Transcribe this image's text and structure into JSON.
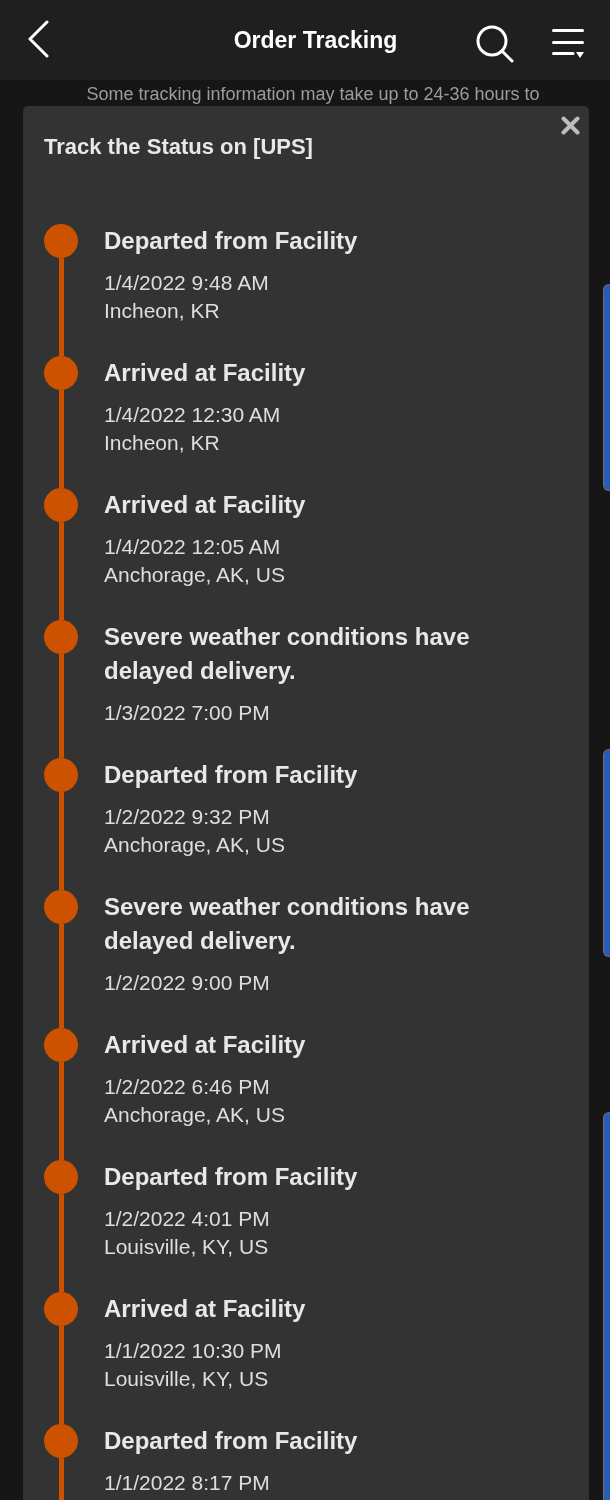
{
  "header": {
    "title": "Order Tracking"
  },
  "notice": "Some tracking information may take up to 24-36 hours to",
  "tracking_dialog": {
    "title": "Track the Status on [UPS]",
    "events": [
      {
        "status": "Departed from Facility",
        "date": "1/4/2022 9:48 AM",
        "location": "Incheon, KR"
      },
      {
        "status": "Arrived at Facility",
        "date": "1/4/2022 12:30 AM",
        "location": "Incheon, KR"
      },
      {
        "status": "Arrived at Facility",
        "date": "1/4/2022 12:05 AM",
        "location": "Anchorage, AK, US"
      },
      {
        "status": "Severe weather conditions have delayed delivery.",
        "date": "1/3/2022 7:00 PM"
      },
      {
        "status": "Departed from Facility",
        "date": "1/2/2022 9:32 PM",
        "location": "Anchorage, AK, US"
      },
      {
        "status": "Severe weather conditions have delayed delivery.",
        "date": "1/2/2022 9:00 PM"
      },
      {
        "status": "Arrived at Facility",
        "date": "1/2/2022 6:46 PM",
        "location": "Anchorage, AK, US"
      },
      {
        "status": "Departed from Facility",
        "date": "1/2/2022 4:01 PM",
        "location": "Louisville, KY, US"
      },
      {
        "status": "Arrived at Facility",
        "date": "1/1/2022 10:30 PM",
        "location": "Louisville, KY, US"
      },
      {
        "status": "Departed from Facility",
        "date": "1/1/2022 8:17 PM"
      }
    ]
  }
}
